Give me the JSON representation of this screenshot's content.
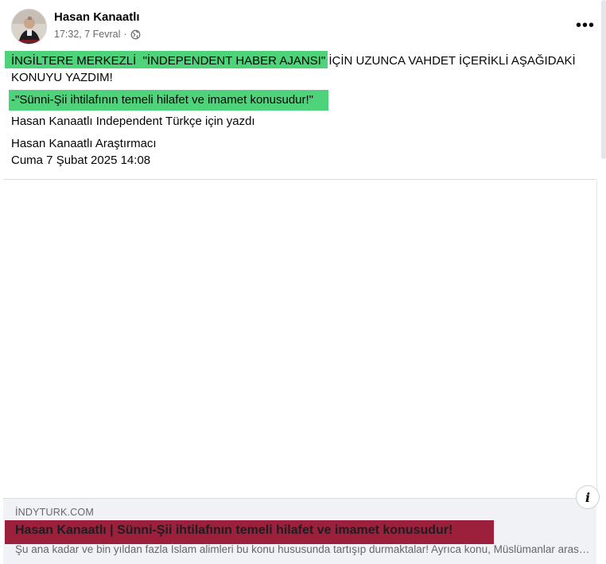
{
  "post": {
    "author_name": "Hasan Kanaatlı",
    "timestamp": "17:32, 7 Fevral",
    "separator": "·",
    "privacy_icon": "globe-icon",
    "more_icon": "more-options-icon",
    "more_glyph": "•••",
    "text": {
      "line1_highlighted": "İNGİLTERE MERKEZLİ  \"İNDEPENDENT HABER AJANSI\" İÇİN",
      "line1_rest": " UZUNCA VAHDET İÇERİKLİ AŞAĞIDAKİ KONUYU YAZDIM!",
      "line2": "-\"Sünni-Şii ihtilafının temeli hilafet ve imamet konusudur!\"",
      "line3": "Hasan Kanaatlı Independent Türkçe için yazdı",
      "line4": "Hasan Kanaatlı Araştırmacı",
      "line5": "Cuma 7 Şubat 2025 14:08"
    }
  },
  "link_preview": {
    "domain": "İNDYTURK.COM",
    "title": "Hasan Kanaatlı | Sünni-Şii ihtilafının temeli hilafet ve imamet konusudur!",
    "description": "Şu ana kadar ve bin yıldan fazla İslam alimleri bu konu hususunda tartışıp durmaktalar! Ayrıca konu, Müslümanlar arasındaki bölünmenin ana sebebidir",
    "info_icon": "info-icon",
    "info_glyph": "i"
  },
  "colors": {
    "highlight_green": "#4fd37a",
    "highlight_red": "#9c1f3c",
    "secondary_text": "#65676b"
  }
}
